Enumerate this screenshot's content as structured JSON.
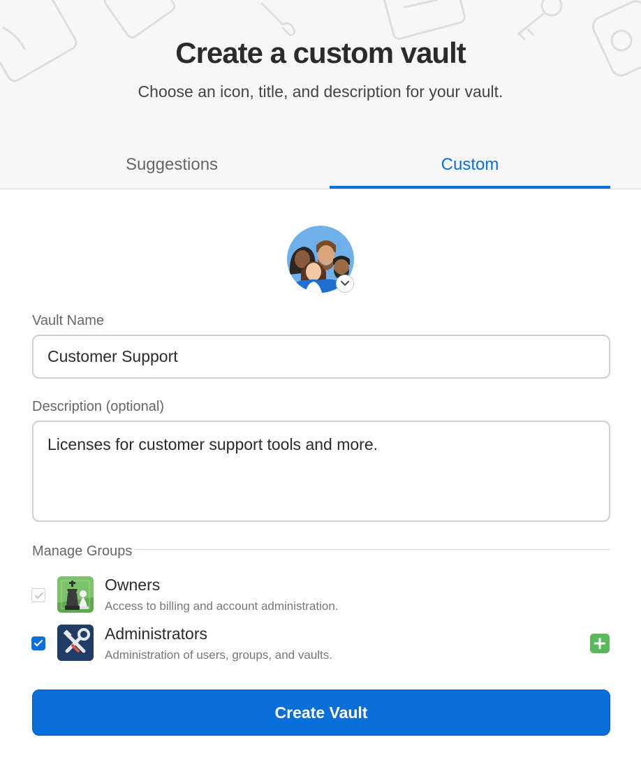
{
  "header": {
    "title": "Create a custom vault",
    "subtitle": "Choose an icon, title, and description for your vault."
  },
  "tabs": [
    {
      "label": "Suggestions",
      "active": false
    },
    {
      "label": "Custom",
      "active": true
    }
  ],
  "vault_icon": {
    "icon": "group-of-people-avatar",
    "menu_icon": "chevron-down-icon"
  },
  "vault_name": {
    "label": "Vault Name",
    "value": "Customer Support"
  },
  "description": {
    "label": "Description (optional)",
    "value": "Licenses for customer support tools and more."
  },
  "groups": {
    "title": "Manage Groups",
    "items": [
      {
        "name": "Owners",
        "description": "Access to billing and account administration.",
        "checked": true,
        "disabled": true,
        "icon": "chess-pieces-icon"
      },
      {
        "name": "Administrators",
        "description": "Administration of users, groups, and vaults.",
        "checked": true,
        "disabled": false,
        "icon": "tools-icon"
      }
    ],
    "add_icon": "plus-icon"
  },
  "actions": {
    "create_label": "Create Vault"
  },
  "colors": {
    "accent": "#0a6fd8",
    "add": "#5cb85c",
    "header_bg": "#f7f7f7"
  }
}
